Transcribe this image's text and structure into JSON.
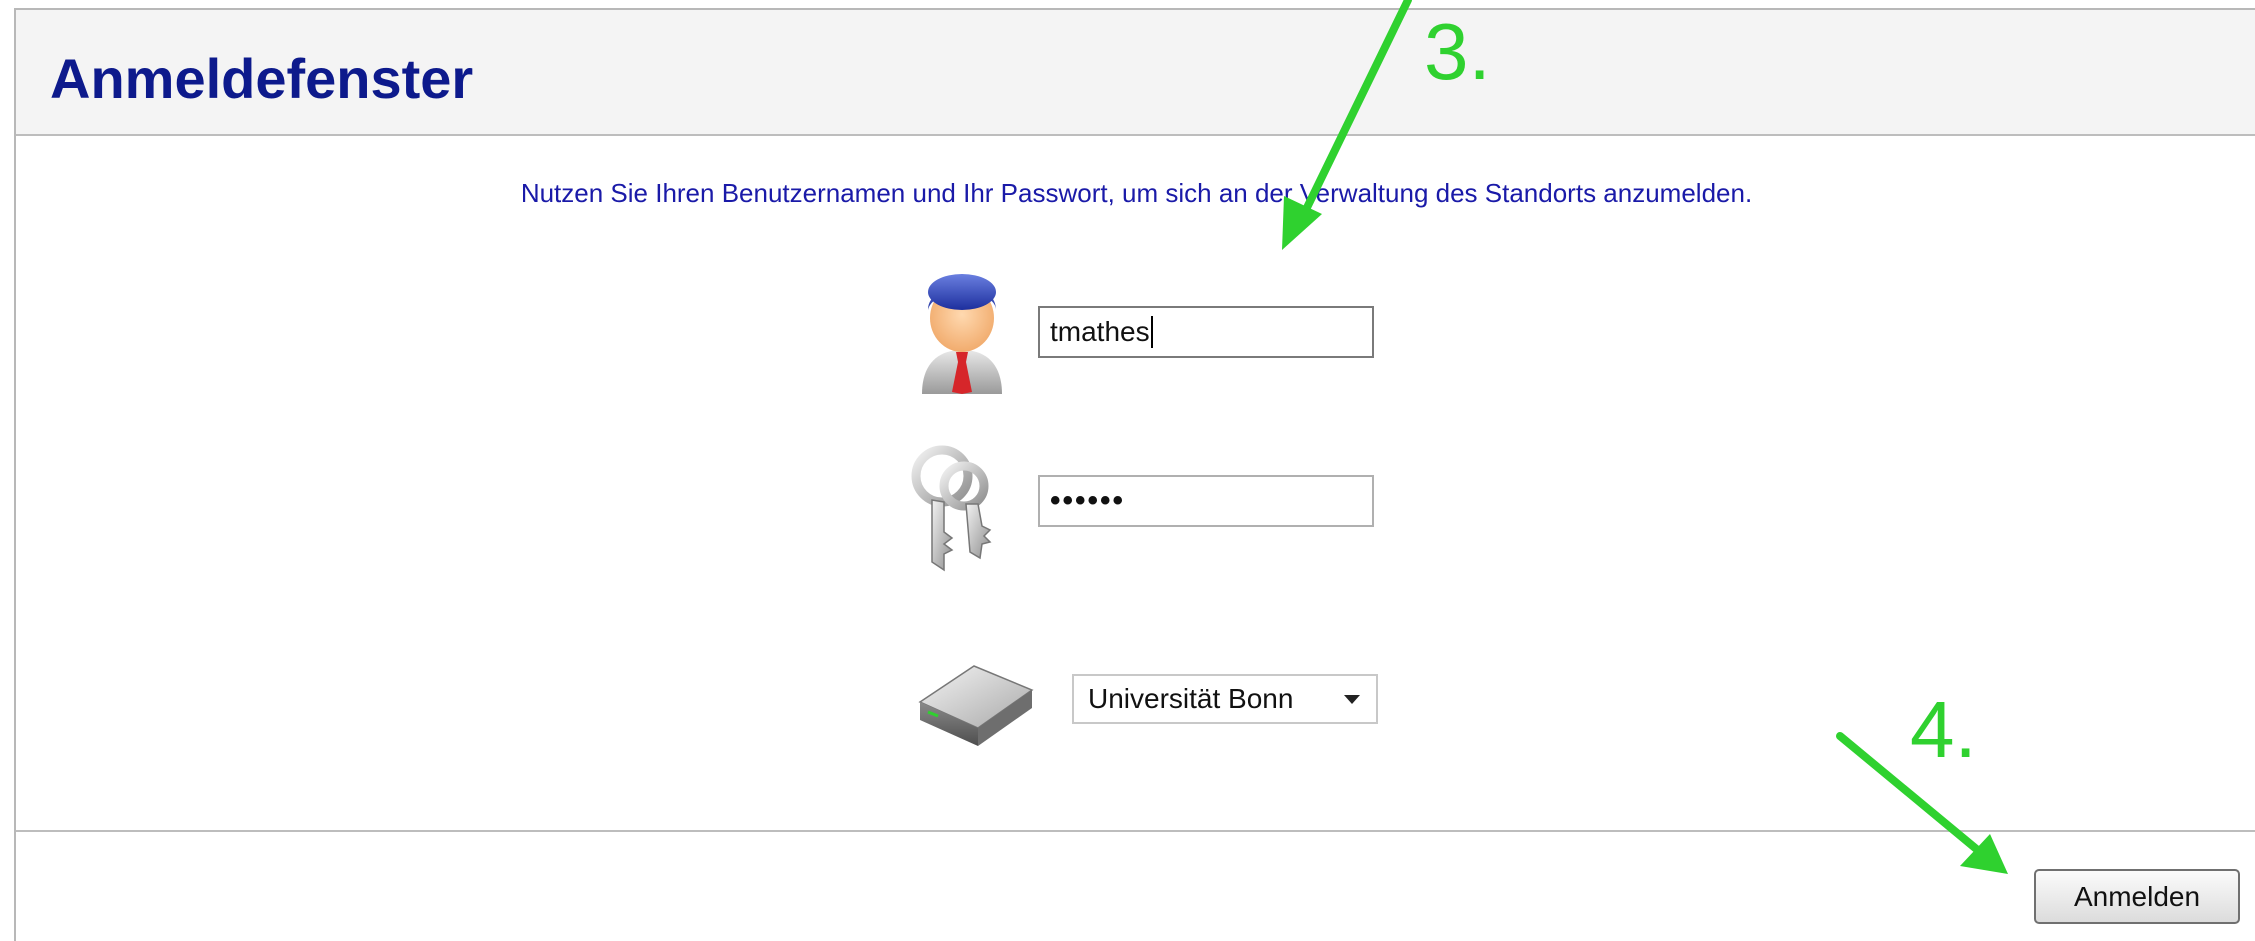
{
  "window": {
    "title": "Anmeldefenster"
  },
  "intro_text": "Nutzen Sie Ihren Benutzernamen und Ihr Passwort, um sich an der Verwaltung des Standorts anzumelden.",
  "login": {
    "username_value": "tmathes",
    "password_value": "••••••",
    "site_selected": "Universität Bonn"
  },
  "buttons": {
    "login_label": "Anmelden"
  },
  "annotations": {
    "step3": "3.",
    "step4": "4."
  },
  "icons": [
    "user-icon",
    "keys-icon",
    "drive-icon",
    "dropdown-arrow-icon"
  ],
  "colors": {
    "title": "#0d1a8c",
    "intro": "#1a1aa8",
    "annotation": "#2fd12f"
  }
}
